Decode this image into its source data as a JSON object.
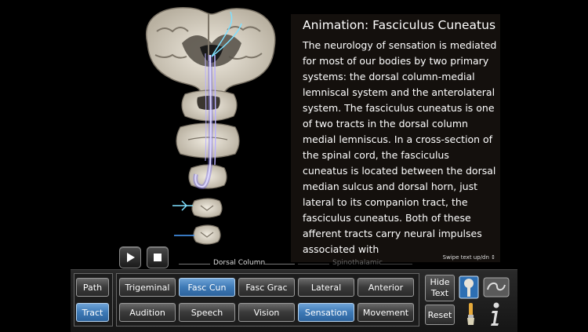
{
  "text_panel": {
    "title": "Animation: Fasciculus Cuneatus",
    "body": "The neurology of sensation is mediated for most of our bodies by two primary systems: the dorsal column-medial lemniscal system and the anterolateral system. The fasciculus cuneatus is one of two tracts in the dorsal column medial lemniscus. In a cross-section of the spinal cord, the fasciculus cuneatus is located between the dorsal median sulcus and dorsal horn, just lateral to its companion tract, the fasciculus cuneatus. Both of these afferent tracts carry neural impulses associated with",
    "swipe_hint": "Swipe text up/dn ↕"
  },
  "section_labels": {
    "dorsal": "Dorsal Column",
    "spinothalamic": "Spinothalamic"
  },
  "view_buttons": {
    "path": "Path",
    "tract": "Tract"
  },
  "tracts_row1": [
    "Trigeminal",
    "Fasc Cun",
    "Fasc Grac",
    "Lateral",
    "Anterior"
  ],
  "tracts_row2": [
    "Audition",
    "Speech",
    "Vision",
    "Sensation",
    "Movement"
  ],
  "side_buttons": {
    "hide_line1": "Hide",
    "hide_line2": "Text",
    "reset": "Reset"
  },
  "colors": {
    "active": "#3d79b5",
    "tract_glow": "#7a6fe0",
    "nerve": "#7fe0ff"
  }
}
